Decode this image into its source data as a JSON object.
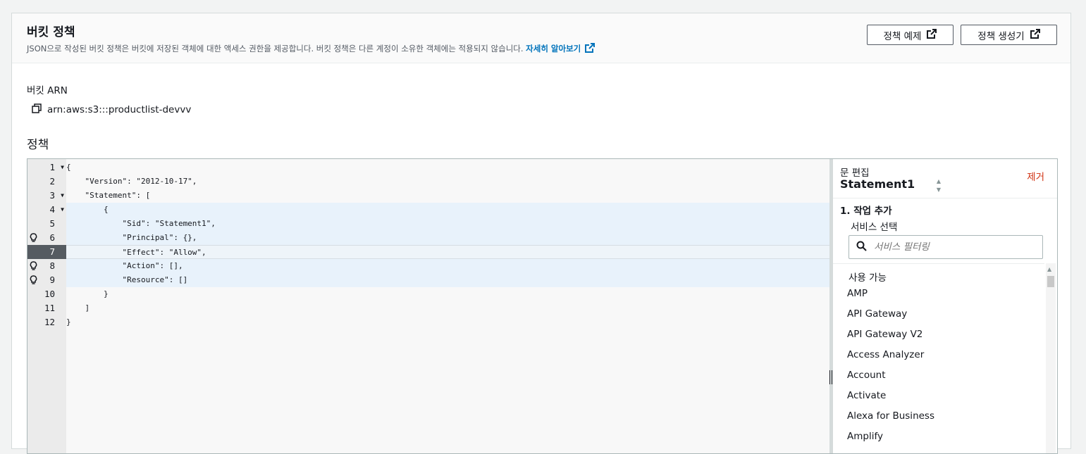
{
  "header": {
    "title": "버킷 정책",
    "description": "JSON으로 작성된 버킷 정책은 버킷에 저장된 객체에 대한 액세스 권한을 제공합니다. 버킷 정책은 다른 계정이 소유한 객체에는 적용되지 않습니다.",
    "learn_more": "자세히 알아보기",
    "examples_button": "정책 예제",
    "generator_button": "정책 생성기"
  },
  "arn": {
    "label": "버킷 ARN",
    "value": "arn:aws:s3:::productlist-devvv"
  },
  "policy": {
    "label": "정책",
    "lines": [
      {
        "num": "1",
        "text": "{"
      },
      {
        "num": "2",
        "text": "    \"Version\": \"2012-10-17\","
      },
      {
        "num": "3",
        "text": "    \"Statement\": ["
      },
      {
        "num": "4",
        "text": "        {"
      },
      {
        "num": "5",
        "text": "            \"Sid\": \"Statement1\","
      },
      {
        "num": "6",
        "text": "            \"Principal\": {},"
      },
      {
        "num": "7",
        "text": "            \"Effect\": \"Allow\","
      },
      {
        "num": "8",
        "text": "            \"Action\": [],"
      },
      {
        "num": "9",
        "text": "            \"Resource\": []"
      },
      {
        "num": "10",
        "text": "        }"
      },
      {
        "num": "11",
        "text": "    ]"
      },
      {
        "num": "12",
        "text": "}"
      }
    ]
  },
  "side_panel": {
    "edit_label": "문 편집",
    "statement_name": "Statement1",
    "remove": "제거",
    "step_title": "1. 작업 추가",
    "service_label": "서비스 선택",
    "search_placeholder": "서비스 필터링",
    "list_header": "사용 가능",
    "services": [
      "AMP",
      "API Gateway",
      "API Gateway V2",
      "Access Analyzer",
      "Account",
      "Activate",
      "Alexa for Business",
      "Amplify"
    ]
  }
}
